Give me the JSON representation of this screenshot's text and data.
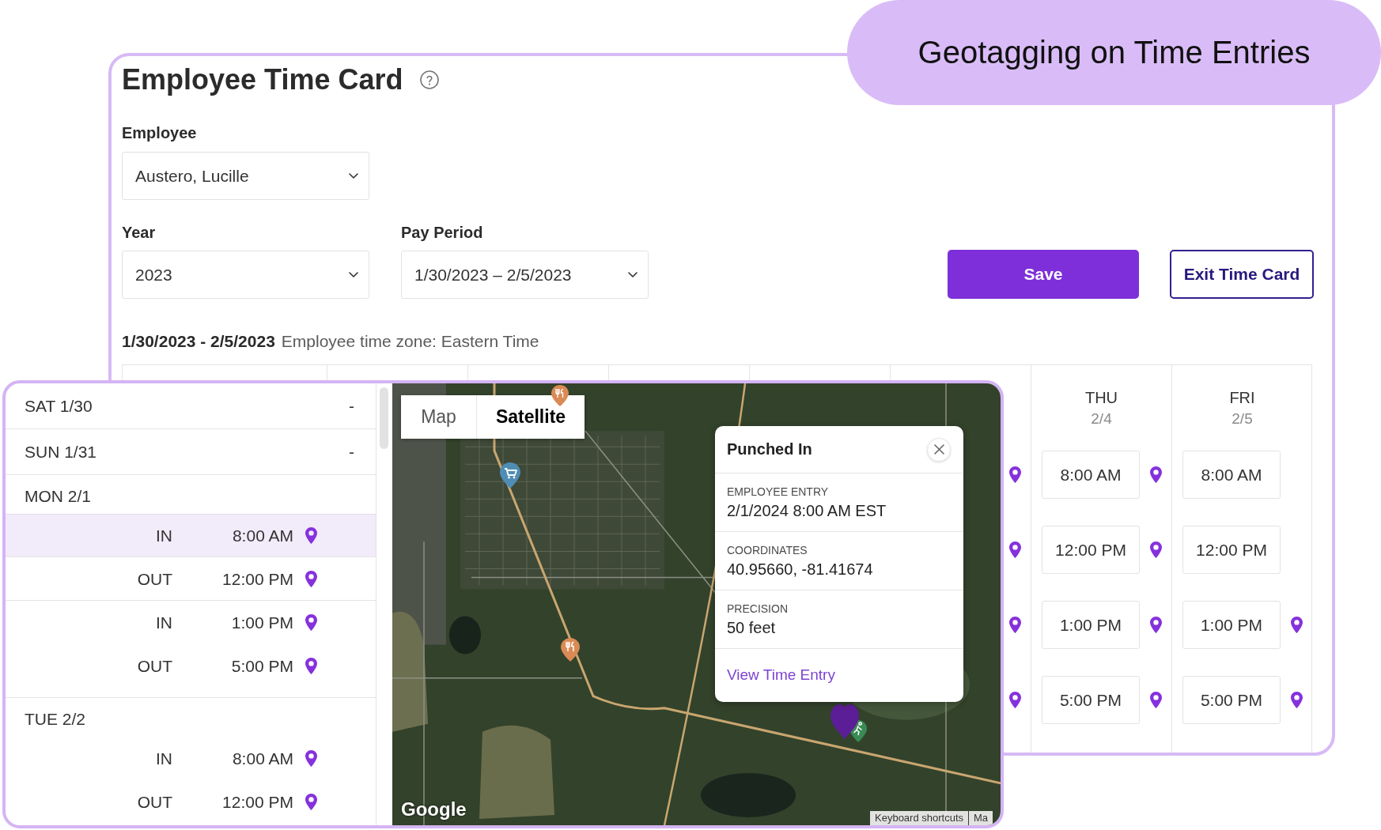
{
  "banner": {
    "title": "Geotagging on Time Entries"
  },
  "time_card": {
    "title": "Employee Time Card",
    "employee": {
      "label": "Employee",
      "value": "Austero, Lucille"
    },
    "year": {
      "label": "Year",
      "value": "2023"
    },
    "pay_period": {
      "label": "Pay Period",
      "value": "1/30/2023 – 2/5/2023"
    },
    "buttons": [
      {
        "label": "Save",
        "kind": "primary"
      },
      {
        "label": "Exit Time Card",
        "kind": "secondary"
      }
    ],
    "range": "1/30/2023 - 2/5/2023",
    "time_zone": "Employee time zone: Eastern Time",
    "week_columns": [
      {
        "entries": [
          {
            "geotagged": true
          },
          {
            "geotagged": true
          },
          {
            "geotagged": true
          },
          {
            "geotagged": true
          }
        ]
      },
      {
        "day": "THU",
        "date": "2/4",
        "entries": [
          {
            "time": "8:00 AM",
            "geotagged": true
          },
          {
            "time": "12:00 PM",
            "geotagged": true
          },
          {
            "time": "1:00 PM",
            "geotagged": true
          },
          {
            "time": "5:00 PM",
            "geotagged": true
          }
        ]
      },
      {
        "day": "FRI",
        "date": "2/5",
        "entries": [
          {
            "time": "8:00 AM",
            "geotagged": false
          },
          {
            "time": "12:00 PM",
            "geotagged": false
          },
          {
            "time": "1:00 PM",
            "geotagged": true
          },
          {
            "time": "5:00 PM",
            "geotagged": true
          }
        ]
      }
    ]
  },
  "day_detail": {
    "days": [
      {
        "kind": "empty",
        "label": "SAT 1/30",
        "value": "-"
      },
      {
        "kind": "empty",
        "label": "SUN 1/31",
        "value": "-"
      },
      {
        "kind": "punched",
        "label": "MON 2/1",
        "punches": [
          {
            "kind": "in",
            "label": "IN",
            "time": "8:00 AM",
            "geotagged": true,
            "selected": true
          },
          {
            "kind": "out",
            "label": "OUT",
            "time": "12:00 PM",
            "geotagged": true,
            "selected": false
          },
          {
            "kind": "in",
            "label": "IN",
            "time": "1:00 PM",
            "geotagged": true,
            "selected": false
          },
          {
            "kind": "out",
            "label": "OUT",
            "time": "5:00 PM",
            "geotagged": true,
            "selected": false
          }
        ]
      },
      {
        "kind": "punched",
        "label": "TUE 2/2",
        "punches": [
          {
            "kind": "in",
            "label": "IN",
            "time": "8:00 AM",
            "geotagged": true,
            "selected": false
          },
          {
            "kind": "out",
            "label": "OUT",
            "time": "12:00 PM",
            "geotagged": true,
            "selected": false
          }
        ]
      }
    ]
  },
  "map": {
    "modes": [
      {
        "label": "Map",
        "selected": false
      },
      {
        "label": "Satellite",
        "selected": true
      }
    ],
    "popup": {
      "title": "Punched In",
      "fields": [
        {
          "label": "EMPLOYEE ENTRY",
          "value": "2/1/2024 8:00 AM EST"
        },
        {
          "label": "COORDINATES",
          "value": "40.95660, -81.41674"
        },
        {
          "label": "PRECISION",
          "value": "50 feet"
        }
      ],
      "link": "View Time Entry"
    },
    "logo": "Google",
    "footer_links": [
      "Keyboard shortcuts",
      "Ma"
    ]
  }
}
